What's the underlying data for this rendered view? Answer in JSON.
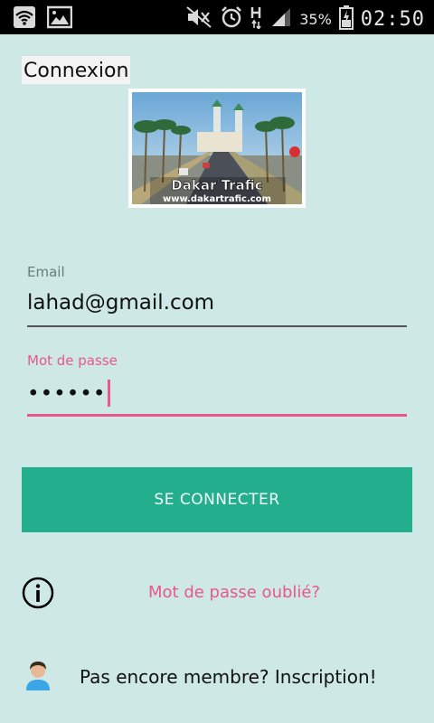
{
  "status_bar": {
    "battery_percent": "35%",
    "time": "02:50",
    "icons": [
      "wifi-icon",
      "gallery-icon",
      "mute-icon",
      "alarm-icon",
      "hspa-icon",
      "signal-icon",
      "battery-icon"
    ]
  },
  "page": {
    "title": "Connexion"
  },
  "logo": {
    "line1": "Dakar Trafic",
    "line2": "www.dakartrafic.com"
  },
  "form": {
    "email": {
      "label": "Email",
      "value": "lahad@gmail.com"
    },
    "password": {
      "label": "Mot de passe",
      "value": "••••••"
    },
    "connect_label": "SE CONNECTER",
    "forgot_label": "Mot de passe oublié?",
    "signup_label": "Pas encore membre? Inscription!"
  },
  "colors": {
    "background": "#cde8e5",
    "accent": "#23ae8e",
    "pink": "#e8578f"
  }
}
